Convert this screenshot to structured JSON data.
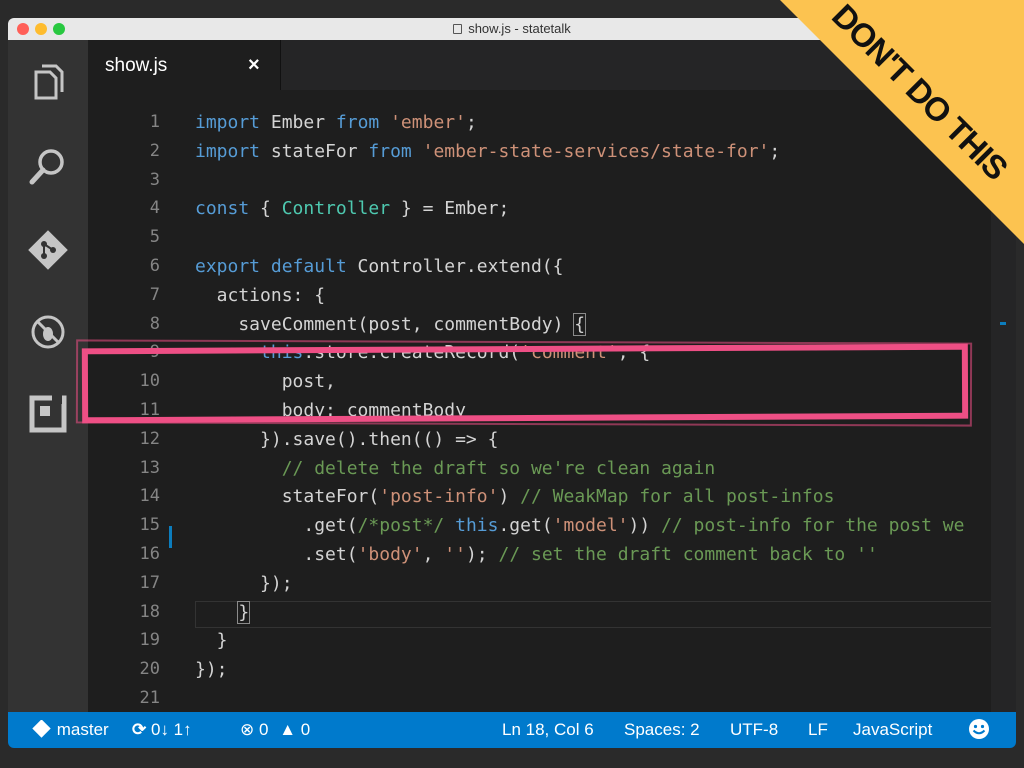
{
  "window": {
    "title": "show.js - statetalk"
  },
  "tab": {
    "label": "show.js",
    "close": "×"
  },
  "code_lines": [
    {
      "n": "1",
      "html": "<span class='k'>import</span> Ember <span class='k'>from</span> <span class='s'>'ember'</span>;"
    },
    {
      "n": "2",
      "html": "<span class='k'>import</span> stateFor <span class='k'>from</span> <span class='s'>'ember-state-services/state-for'</span>;"
    },
    {
      "n": "3",
      "html": ""
    },
    {
      "n": "4",
      "html": "<span class='k'>const</span> { <span class='cls'>Controller</span> } = Ember;"
    },
    {
      "n": "5",
      "html": ""
    },
    {
      "n": "6",
      "html": "<span class='k'>export default</span> Controller.extend({"
    },
    {
      "n": "7",
      "html": "  actions: {"
    },
    {
      "n": "8",
      "html": "    saveComment(post, commentBody) <span class='br'>{</span>"
    },
    {
      "n": "9",
      "html": "      <span class='k'>this</span>.store.createRecord(<span class='s'>'comment'</span>, {"
    },
    {
      "n": "10",
      "html": "        post,"
    },
    {
      "n": "11",
      "html": "        body: commentBody"
    },
    {
      "n": "12",
      "html": "      }).save().then(() => {"
    },
    {
      "n": "13",
      "html": "        <span class='c'>// delete the draft so we're clean again</span>"
    },
    {
      "n": "14",
      "html": "        stateFor(<span class='s'>'post-info'</span>) <span class='c'>// WeakMap for all post-infos</span>"
    },
    {
      "n": "15",
      "html": "          .get(<span class='c'>/*post*/</span> <span class='k'>this</span>.get(<span class='s'>'model'</span>)) <span class='c'>// post-info for the post we</span>"
    },
    {
      "n": "16",
      "html": "          .set(<span class='s'>'body'</span>, <span class='s'>''</span>); <span class='c'>// set the draft comment back to ''</span>"
    },
    {
      "n": "17",
      "html": "      });"
    },
    {
      "n": "18",
      "html": "    <span class='br'>}</span>"
    },
    {
      "n": "19",
      "html": "  }"
    },
    {
      "n": "20",
      "html": "});"
    },
    {
      "n": "21",
      "html": ""
    }
  ],
  "statusbar": {
    "branch": "master",
    "sync": "0↓ 1↑",
    "errors": "0",
    "warnings": "0",
    "position": "Ln 18, Col 6",
    "spaces": "Spaces: 2",
    "encoding": "UTF-8",
    "eol": "LF",
    "language": "JavaScript"
  },
  "banner": {
    "text": "DON'T DO THIS"
  },
  "colors": {
    "accent": "#007acc",
    "highlight": "#ee4f85",
    "banner": "#fcc350"
  },
  "icons": [
    "explorer-icon",
    "search-icon",
    "git-icon",
    "debug-icon",
    "extensions-icon",
    "branch-icon",
    "sync-icon",
    "error-icon",
    "warning-icon",
    "smiley-icon"
  ]
}
